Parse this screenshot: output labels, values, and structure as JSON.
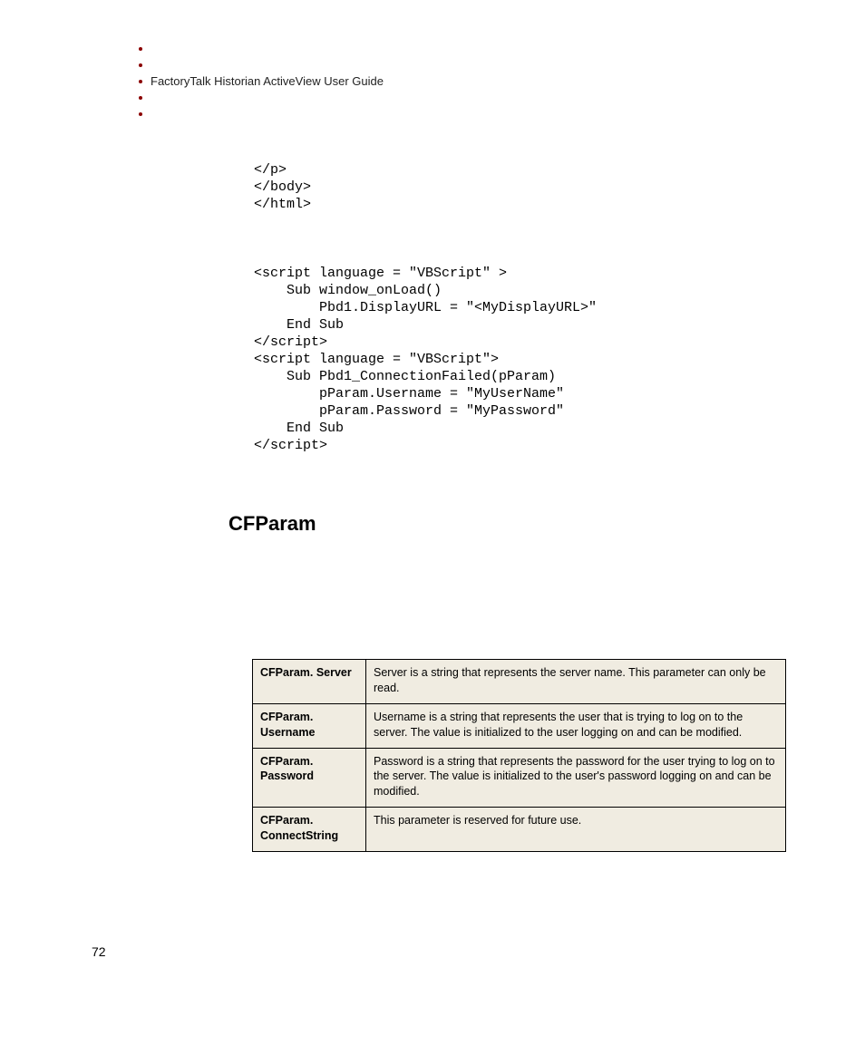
{
  "header": {
    "guide_title": "FactoryTalk Historian ActiveView User Guide"
  },
  "code": {
    "lines": [
      "</p>",
      "</body>",
      "</html>",
      "",
      "",
      "",
      "<script language = \"VBScript\" >",
      "    Sub window_onLoad()",
      "        Pbd1.DisplayURL = \"<MyDisplayURL>\"",
      "    End Sub",
      "</script>",
      "<script language = \"VBScript\">",
      "    Sub Pbd1_ConnectionFailed(pParam)",
      "        pParam.Username = \"MyUserName\"",
      "        pParam.Password = \"MyPassword\"",
      "    End Sub",
      "</script>"
    ]
  },
  "section": {
    "heading": "CFParam"
  },
  "table": {
    "rows": [
      {
        "param": "CFParam. Server",
        "desc": "Server is a string that represents the server name. This parameter can only be read."
      },
      {
        "param": "CFParam. Username",
        "desc": "Username is a string that represents the user that is trying to log on to the server. The value is initialized to the user logging on and can be modified."
      },
      {
        "param": "CFParam. Password",
        "desc": "Password is a string that represents the password for the user trying to log on to the server. The value is initialized to the user's password logging on and can be modified."
      },
      {
        "param": "CFParam. ConnectString",
        "desc": "This parameter is reserved for future use."
      }
    ]
  },
  "footer": {
    "page_number": "72"
  }
}
